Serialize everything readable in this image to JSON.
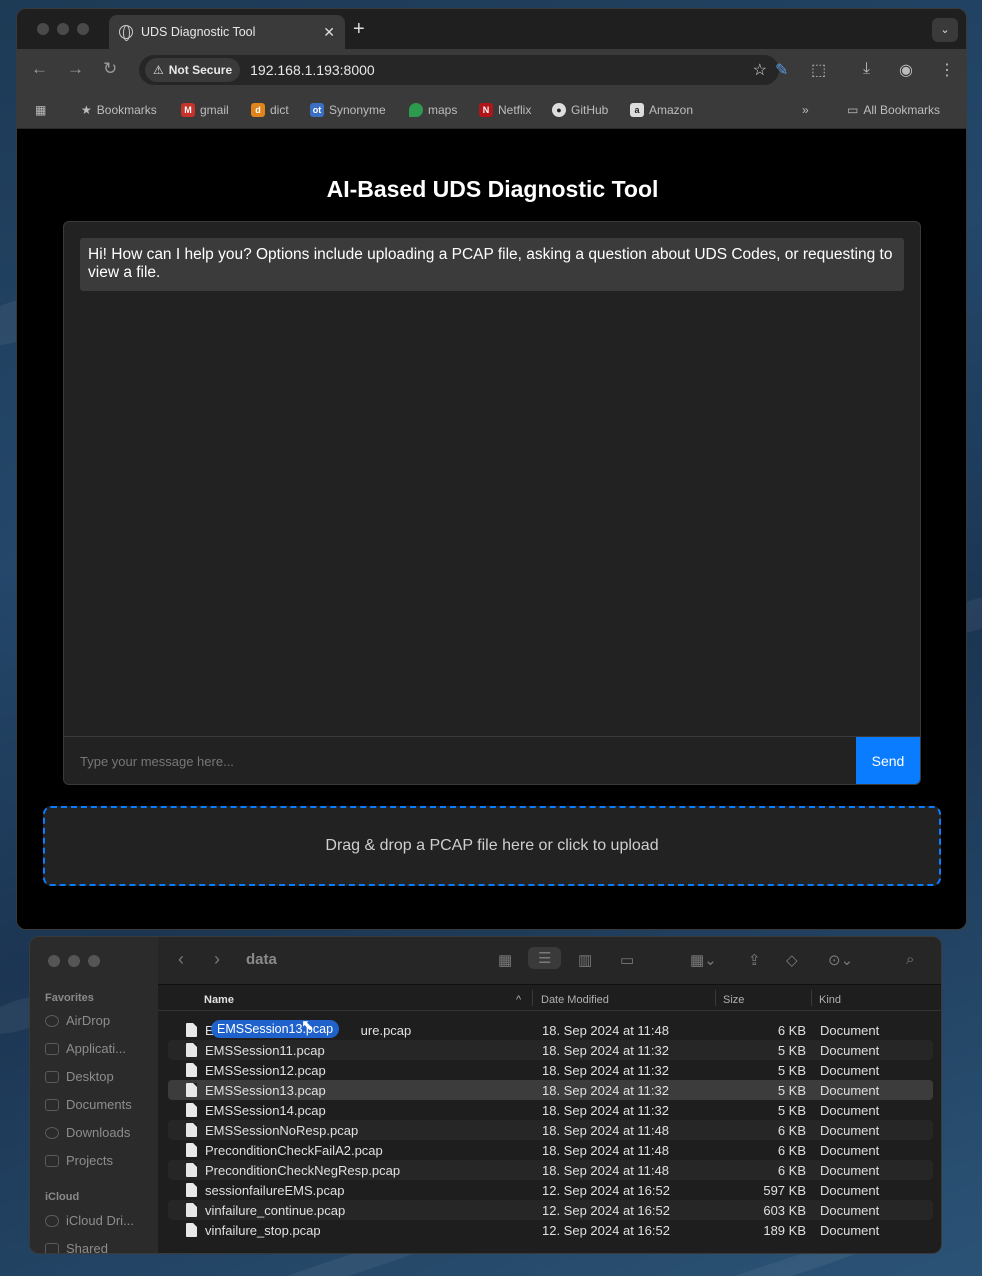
{
  "browser": {
    "tab_title": "UDS Diagnostic Tool",
    "tab_close": "✕",
    "new_tab": "+",
    "security_label": "Not Secure",
    "url": "192.168.1.193:8000",
    "bookmarks": [
      {
        "label": "Bookmarks",
        "icon": "star-icon"
      },
      {
        "label": "gmail",
        "icon": "gmail-icon"
      },
      {
        "label": "dict",
        "icon": "dict-icon"
      },
      {
        "label": "Synonyme",
        "icon": "synonyme-icon"
      },
      {
        "label": "maps",
        "icon": "maps-icon"
      },
      {
        "label": "Netflix",
        "icon": "netflix-icon"
      },
      {
        "label": "GitHub",
        "icon": "github-icon"
      },
      {
        "label": "Amazon",
        "icon": "amazon-icon"
      }
    ],
    "all_bookmarks": "All Bookmarks"
  },
  "app": {
    "title": "AI-Based UDS Diagnostic Tool",
    "bot_message": "Hi! How can I help you? Options include uploading a PCAP file, asking a question about UDS Codes, or requesting to view a file.",
    "input_placeholder": "Type your message here...",
    "send_label": "Send",
    "dropzone_text": "Drag & drop a PCAP file here or click to upload",
    "accent_color": "#0a7cff"
  },
  "finder": {
    "folder": "data",
    "sidebar": {
      "favorites_head": "Favorites",
      "favorites": [
        "AirDrop",
        "Applicati...",
        "Desktop",
        "Documents",
        "Downloads",
        "Projects"
      ],
      "icloud_head": "iCloud",
      "icloud": [
        "iCloud Dri...",
        "Shared"
      ]
    },
    "columns": {
      "name": "Name",
      "date": "Date Modified",
      "size": "Size",
      "kind": "Kind"
    },
    "drag_label": "EMSSession13.pcap",
    "first_row_suffix": "ure.pcap",
    "files": [
      {
        "name": "E",
        "date": "18. Sep 2024 at 11:48",
        "size": "6 KB",
        "kind": "Document"
      },
      {
        "name": "EMSSession11.pcap",
        "date": "18. Sep 2024 at 11:32",
        "size": "5 KB",
        "kind": "Document"
      },
      {
        "name": "EMSSession12.pcap",
        "date": "18. Sep 2024 at 11:32",
        "size": "5 KB",
        "kind": "Document"
      },
      {
        "name": "EMSSession13.pcap",
        "date": "18. Sep 2024 at 11:32",
        "size": "5 KB",
        "kind": "Document"
      },
      {
        "name": "EMSSession14.pcap",
        "date": "18. Sep 2024 at 11:32",
        "size": "5 KB",
        "kind": "Document"
      },
      {
        "name": "EMSSessionNoResp.pcap",
        "date": "18. Sep 2024 at 11:48",
        "size": "6 KB",
        "kind": "Document"
      },
      {
        "name": "PreconditionCheckFailA2.pcap",
        "date": "18. Sep 2024 at 11:48",
        "size": "6 KB",
        "kind": "Document"
      },
      {
        "name": "PreconditionCheckNegResp.pcap",
        "date": "18. Sep 2024 at 11:48",
        "size": "6 KB",
        "kind": "Document"
      },
      {
        "name": "sessionfailureEMS.pcap",
        "date": "12. Sep 2024 at 16:52",
        "size": "597 KB",
        "kind": "Document"
      },
      {
        "name": "vinfailure_continue.pcap",
        "date": "12. Sep 2024 at 16:52",
        "size": "603 KB",
        "kind": "Document"
      },
      {
        "name": "vinfailure_stop.pcap",
        "date": "12. Sep 2024 at 16:52",
        "size": "189 KB",
        "kind": "Document"
      }
    ]
  }
}
